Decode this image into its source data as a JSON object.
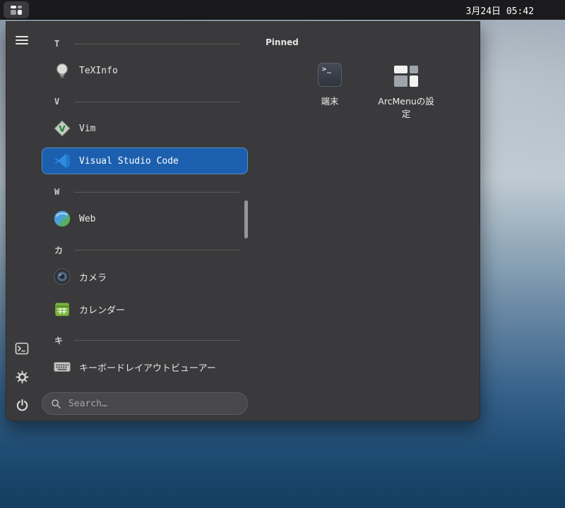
{
  "topbar": {
    "clock": "3月24日 05:42"
  },
  "menu": {
    "pinned_header": "Pinned",
    "search_placeholder": "Search…",
    "groups": [
      {
        "letter": "T",
        "items": [
          {
            "label": "TeXInfo",
            "icon": "lightbulb-icon",
            "selected": false
          }
        ]
      },
      {
        "letter": "V",
        "items": [
          {
            "label": "Vim",
            "icon": "vim-icon",
            "selected": false
          },
          {
            "label": "Visual Studio Code",
            "icon": "vscode-icon",
            "selected": true
          }
        ]
      },
      {
        "letter": "W",
        "items": [
          {
            "label": "Web",
            "icon": "web-globe-icon",
            "selected": false
          }
        ]
      },
      {
        "letter": "カ",
        "items": [
          {
            "label": "カメラ",
            "icon": "camera-icon",
            "selected": false
          },
          {
            "label": "カレンダー",
            "icon": "calendar-icon",
            "selected": false
          }
        ]
      },
      {
        "letter": "キ",
        "items": [
          {
            "label": "キーボードレイアウトビューアー",
            "icon": "keyboard-icon",
            "selected": false
          }
        ]
      }
    ],
    "pinned": [
      {
        "label": "端末",
        "icon": "terminal-icon"
      },
      {
        "label": "ArcMenuの設定",
        "icon": "arcmenu-icon"
      }
    ],
    "sidebar_icons": [
      "hamburger-menu-icon",
      "terminal-icon",
      "settings-gear-icon",
      "power-icon"
    ]
  },
  "colors": {
    "accent": "#1c5fae",
    "panel_bg": "#3a3a3c",
    "topbar_bg": "#1b1b1d"
  }
}
